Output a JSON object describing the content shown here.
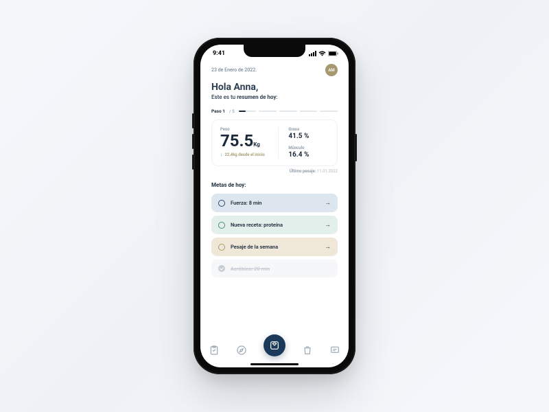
{
  "status": {
    "time": "9:41"
  },
  "header": {
    "date": "23 de Enero de 2022.",
    "avatar_initials": "AM"
  },
  "greeting": {
    "hello": "Hola Anna,",
    "subtitle_pre": "Este es tu ",
    "subtitle_bold": "resumen de hoy",
    "subtitle_post": ":"
  },
  "steps": {
    "label": "Paso 1",
    "total": "/ 5"
  },
  "metrics": {
    "weight_label": "Peso",
    "weight_value": "75.5",
    "weight_unit": "Kg",
    "delta": "22,4kg desde el inicio",
    "fat_label": "Grasa",
    "fat_value": "41.5 %",
    "muscle_label": "Músculo",
    "muscle_value": "16.4 %"
  },
  "last_weigh": {
    "label": "Último pesaje:",
    "date": "11.01.2022"
  },
  "goals": {
    "title": "Metas de hoy:",
    "items": [
      {
        "text": "Fuerza: 8 min"
      },
      {
        "text": "Nueva receta: proteína"
      },
      {
        "text": "Pesaje de la semana"
      },
      {
        "text": "Aeróbico: 20 min"
      }
    ]
  }
}
